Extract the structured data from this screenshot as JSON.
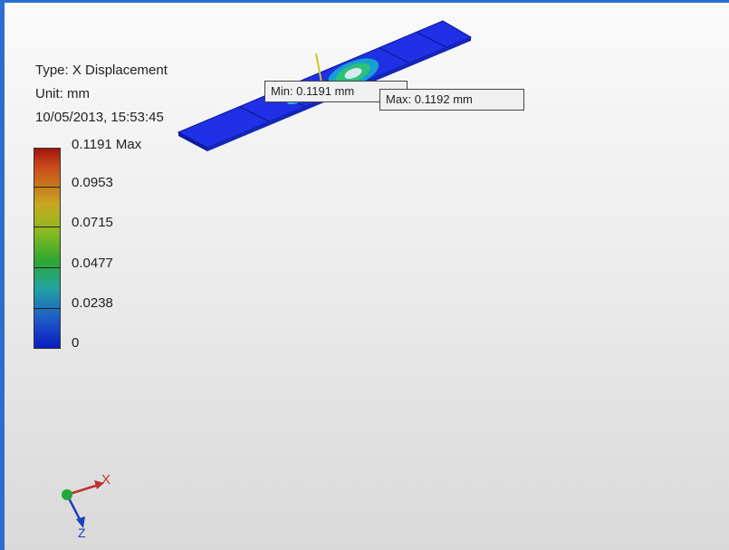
{
  "result_info": {
    "type_line": "Type: X Displacement",
    "unit_line": "Unit: mm",
    "timestamp": "10/05/2013, 15:53:45"
  },
  "legend": {
    "labels": [
      "0.1191 Max",
      "0.0953",
      "0.0715",
      "0.0477",
      "0.0238",
      "0"
    ]
  },
  "probes": {
    "min_label": "Min: 0.1191 mm",
    "max_label": "Max: 0.1192 mm"
  },
  "triad": {
    "x_label": "X",
    "z_label": "Z"
  },
  "colors": {
    "frame_border": "#2a6ed0",
    "part_blue": "#1f2fe0",
    "x_axis": "#c03030",
    "z_axis": "#2040c0",
    "y_origin": "#1ea83a"
  }
}
